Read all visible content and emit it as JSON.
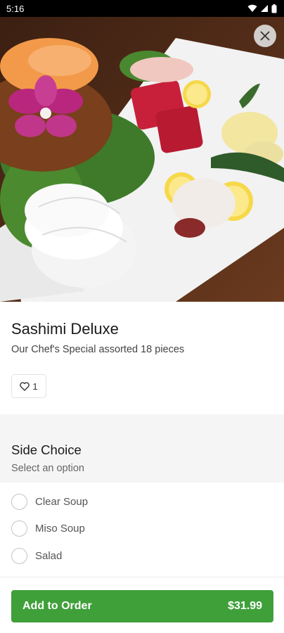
{
  "status_bar": {
    "time": "5:16"
  },
  "item": {
    "name": "Sashimi Deluxe",
    "description": "Our Chef's Special assorted 18 pieces",
    "likes": "1"
  },
  "side_choice": {
    "title": "Side Choice",
    "subtitle": "Select an option",
    "options": [
      {
        "label": "Clear Soup"
      },
      {
        "label": "Miso Soup"
      },
      {
        "label": "Salad"
      }
    ]
  },
  "footer": {
    "button_label": "Add to Order",
    "price": "$31.99"
  },
  "icons": {
    "close": "close-icon",
    "like": "heart-icon",
    "wifi": "wifi-icon",
    "signal": "signal-icon",
    "battery": "battery-icon"
  },
  "colors": {
    "accent": "#3fa03a",
    "section_bg": "#f5f5f5"
  }
}
